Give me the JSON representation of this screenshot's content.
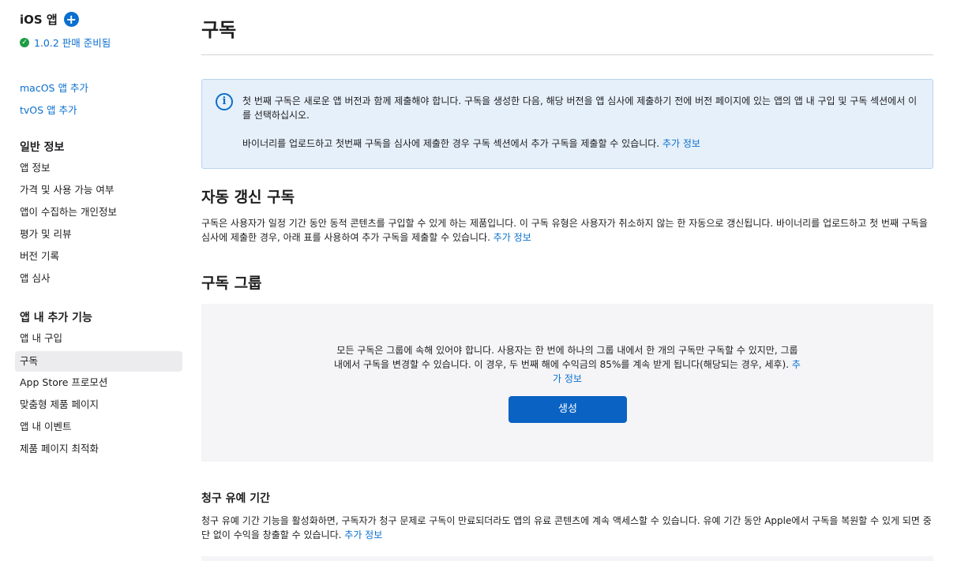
{
  "sidebar": {
    "app_title": "iOS 앱",
    "add_symbol": "+",
    "version_check": "✓",
    "version_status": "1.0.2 판매 준비됨",
    "add_links": [
      "macOS 앱 추가",
      "tvOS 앱 추가"
    ],
    "general_heading": "일반 정보",
    "general_items": [
      "앱 정보",
      "가격 및 사용 가능 여부",
      "앱이 수집하는 개인정보",
      "평가 및 리뷰",
      "버전 기록",
      "앱 심사"
    ],
    "features_heading": "앱 내 추가 기능",
    "features_items": [
      "앱 내 구입",
      "구독",
      "App Store 프로모션",
      "맞춤형 제품 페이지",
      "앱 내 이벤트",
      "제품 페이지 최적화"
    ],
    "active_item": "구독"
  },
  "main": {
    "title": "구독",
    "info": {
      "icon_glyph": "i",
      "text1": "첫 번째 구독은 새로운 앱 버전과 함께 제출해야 합니다. 구독을 생성한 다음, 해당 버전을 앱 심사에 제출하기 전에 버전 페이지에 있는 앱의 앱 내 구입 및 구독 섹션에서 이를 선택하십시오.",
      "text2": "바이너리를 업로드하고 첫번째 구독을 심사에 제출한 경우 구독 섹션에서 추가 구독을 제출할 수 있습니다.",
      "link": "추가 정보"
    },
    "auto_renew": {
      "heading": "자동 갱신 구독",
      "text": "구독은 사용자가 일정 기간 동안 동적 콘텐츠를 구입할 수 있게 하는 제품입니다. 이 구독 유형은 사용자가 취소하지 않는 한 자동으로 갱신됩니다. 바이너리를 업로드하고 첫 번째 구독을 심사에 제출한 경우, 아래 표를 사용하여 추가 구독을 제출할 수 있습니다.",
      "link": "추가 정보"
    },
    "groups": {
      "heading": "구독 그룹",
      "text": "모든 구독은 그룹에 속해 있어야 합니다. 사용자는 한 번에 하나의 그룹 내에서 한 개의 구독만 구독할 수 있지만, 그룹 내에서 구독을 변경할 수 있습니다. 이 경우, 두 번째 해에 수익금의 85%를 계속 받게 됩니다(해당되는 경우, 세후).",
      "link": "추가 정보",
      "create_button": "생성"
    },
    "grace": {
      "heading": "청구 유예 기간",
      "text": "청구 유예 기간 기능을 활성화하면, 구독자가 청구 문제로 구독이 만료되더라도 앱의 유료 콘텐츠에 계속 액세스할 수 있습니다. 유예 기간 동안 Apple에서 구독을 복원할 수 있게 되면 중단 없이 수익을 창출할 수 있습니다.",
      "link": "추가 정보"
    }
  },
  "colors": {
    "accent": "#0a6fcf",
    "button": "#0a63c3",
    "success": "#1e9c45",
    "info_bg": "#e6f0fa",
    "panel_bg": "#f5f5f7"
  }
}
